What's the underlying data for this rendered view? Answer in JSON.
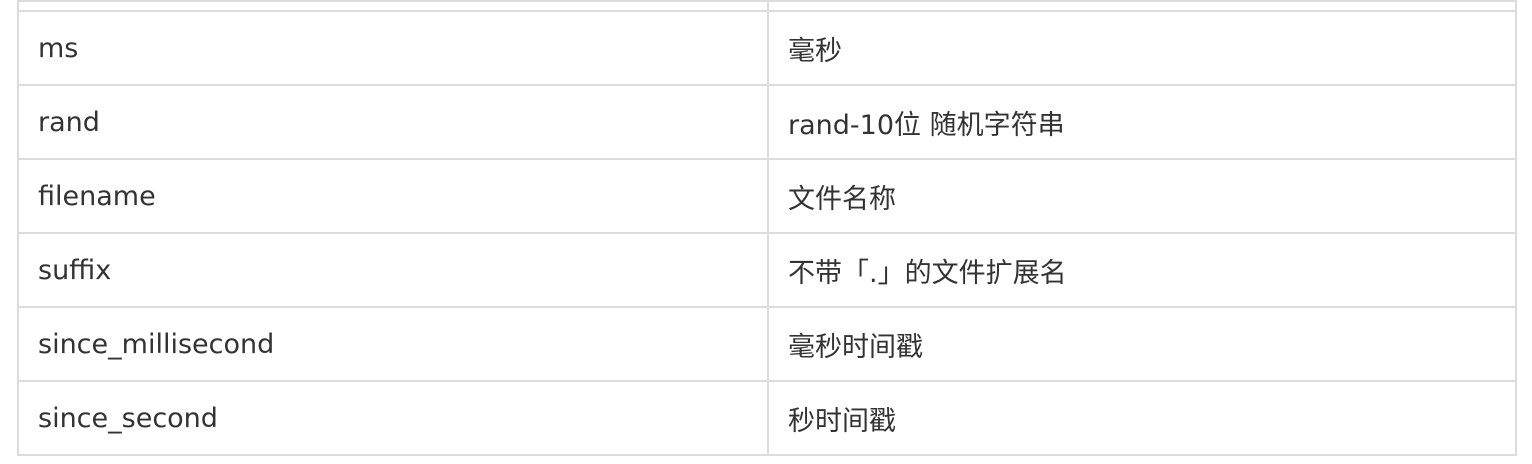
{
  "table": {
    "rows": [
      {
        "key": "ms",
        "desc": "毫秒"
      },
      {
        "key": "rand",
        "desc": "rand-10位 随机字符串"
      },
      {
        "key": "filename",
        "desc": "文件名称"
      },
      {
        "key": "suffix",
        "desc": "不带「.」的文件扩展名"
      },
      {
        "key": "since_millisecond",
        "desc": "毫秒时间戳"
      },
      {
        "key": "since_second",
        "desc": "秒时间戳"
      }
    ]
  }
}
